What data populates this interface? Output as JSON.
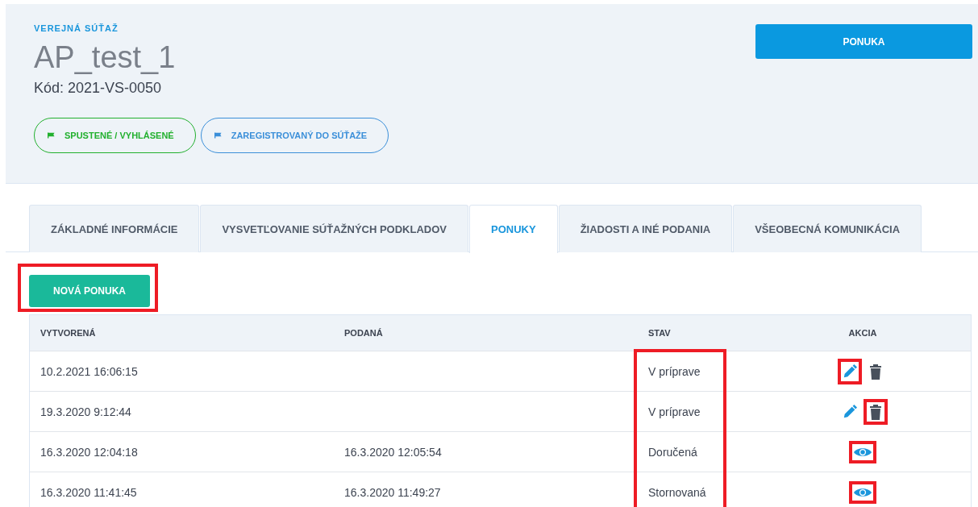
{
  "header": {
    "kicker": "VEREJNÁ SÚŤAŽ",
    "title": "AP_test_1",
    "code": "Kód: 2021-VS-0050",
    "primary_button": "PONUKA",
    "badges": [
      {
        "label": "SPUSTENÉ / VYHLÁSENÉ",
        "color": "#22b02e"
      },
      {
        "label": "ZAREGISTROVANÝ DO SÚŤAŽE",
        "color": "#3b8fd9"
      }
    ]
  },
  "tabs": [
    {
      "label": "ZÁKLADNÉ INFORMÁCIE",
      "selected": false
    },
    {
      "label": "VYSVETĽOVANIE SÚŤAŽNÝCH PODKLADOV",
      "selected": false
    },
    {
      "label": "PONUKY",
      "selected": true
    },
    {
      "label": "ŽIADOSTI A INÉ PODANIA",
      "selected": false
    },
    {
      "label": "VŠEOBECNÁ KOMUNIKÁCIA",
      "selected": false
    }
  ],
  "new_offer_button": {
    "label": "NOVÁ PONUKA",
    "highlighted": true
  },
  "table": {
    "columns": [
      "VYTVORENÁ",
      "PODANÁ",
      "STAV",
      "AKCIA"
    ],
    "status_highlighted": true,
    "rows": [
      {
        "created": "10.2.2021 16:06:15",
        "submitted": "",
        "status": "V príprave",
        "actions": [
          {
            "kind": "edit",
            "highlighted": true
          },
          {
            "kind": "delete",
            "highlighted": false
          }
        ]
      },
      {
        "created": "19.3.2020 9:12:44",
        "submitted": "",
        "status": "V príprave",
        "actions": [
          {
            "kind": "edit",
            "highlighted": false
          },
          {
            "kind": "delete",
            "highlighted": true
          }
        ]
      },
      {
        "created": "16.3.2020 12:04:18",
        "submitted": "16.3.2020 12:05:54",
        "status": "Doručená",
        "actions": [
          {
            "kind": "view",
            "highlighted": true
          }
        ]
      },
      {
        "created": "16.3.2020 11:41:45",
        "submitted": "16.3.2020 11:49:27",
        "status": "Stornovaná",
        "actions": [
          {
            "kind": "view",
            "highlighted": true
          }
        ]
      }
    ]
  }
}
